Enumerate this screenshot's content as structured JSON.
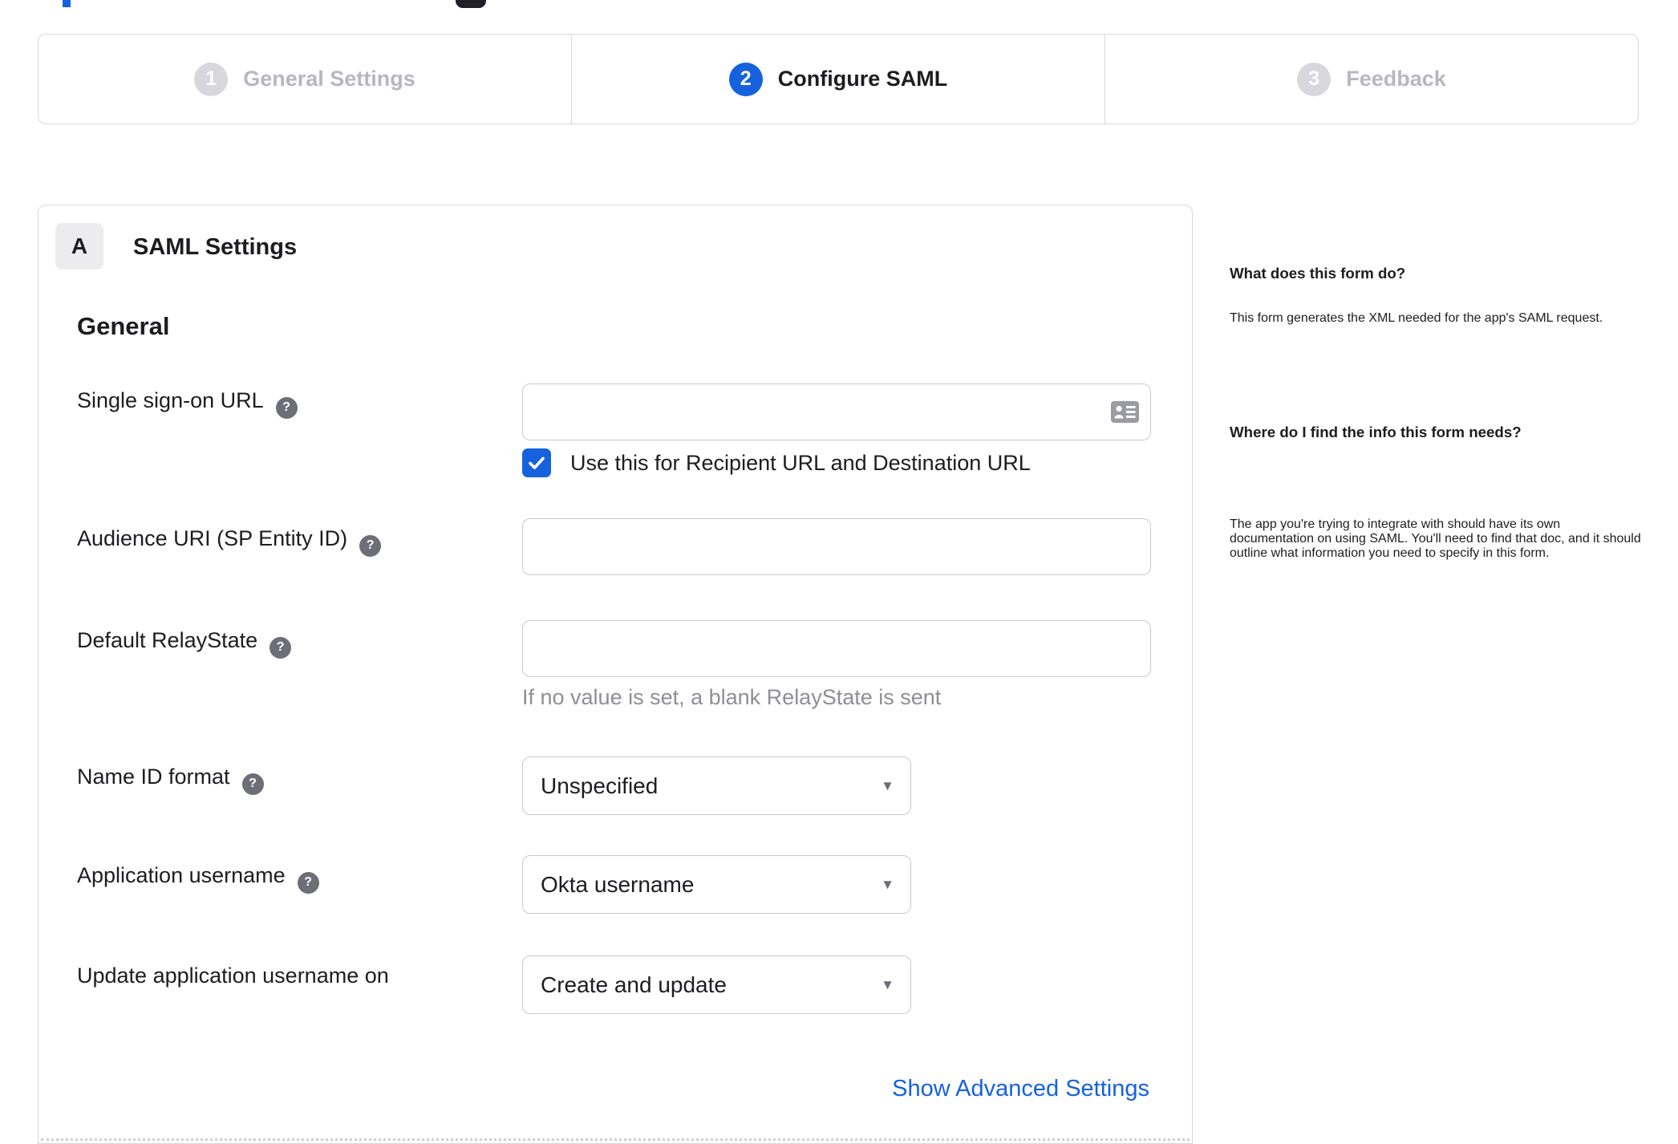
{
  "colors": {
    "accent_blue": "#1662dd",
    "inactive_gray": "#b7b7bf",
    "border_gray": "#d8d8dc",
    "help_icon_gray": "#6e6e78",
    "hint_gray": "#8e8e96"
  },
  "stepper": {
    "steps": [
      {
        "number": "1",
        "label": "General Settings",
        "state": "inactive"
      },
      {
        "number": "2",
        "label": "Configure SAML",
        "state": "active"
      },
      {
        "number": "3",
        "label": "Feedback",
        "state": "inactive"
      }
    ]
  },
  "panel": {
    "badge": "A",
    "title": "SAML Settings",
    "section_heading": "General",
    "sso_url": {
      "label": "Single sign-on URL",
      "value": "",
      "help": "?"
    },
    "sso_checkbox": {
      "label": "Use this for Recipient URL and Destination URL",
      "checked": true
    },
    "audience_uri": {
      "label": "Audience URI (SP Entity ID)",
      "value": "",
      "help": "?"
    },
    "relay_state": {
      "label": "Default RelayState",
      "value": "",
      "help": "?",
      "hint": "If no value is set, a blank RelayState is sent"
    },
    "name_id_format": {
      "label": "Name ID format",
      "value": "Unspecified",
      "help": "?"
    },
    "app_username": {
      "label": "Application username",
      "value": "Okta username",
      "help": "?"
    },
    "update_app_username": {
      "label": "Update application username on",
      "value": "Create and update"
    },
    "advanced_link": "Show Advanced Settings"
  },
  "sidebar": {
    "sections": [
      {
        "heading": "What does this form do?",
        "body": "This form generates the XML needed for the app's SAML request."
      },
      {
        "heading": "Where do I find the info this form needs?",
        "body": "The app you're trying to integrate with should have its own documentation on using SAML. You'll need to find that doc, and it should outline what information you need to specify in this form."
      }
    ]
  }
}
